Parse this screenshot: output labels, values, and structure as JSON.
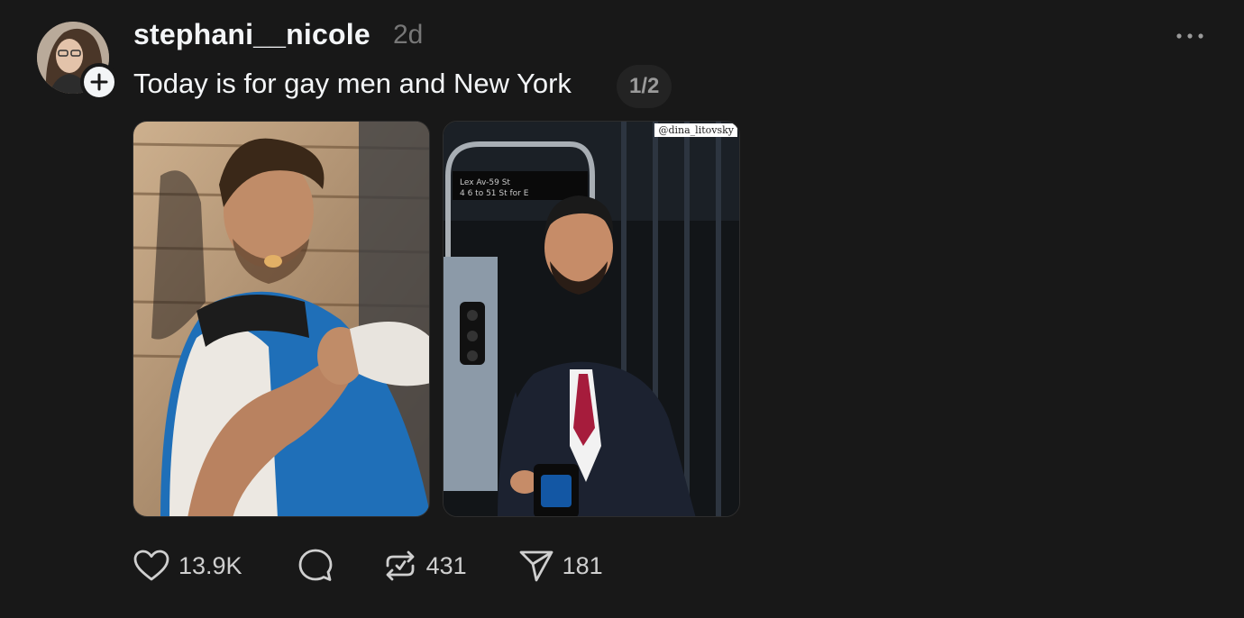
{
  "post": {
    "username": "stephani__nicole",
    "timestamp": "2d",
    "caption": "Today is for gay men and New York",
    "page_indicator": "1/2",
    "photo_credit": "@dina_litovsky",
    "stats": {
      "likes": "13.9K",
      "reposts": "431",
      "shares": "181"
    }
  },
  "colors": {
    "background": "#181818",
    "primary_text": "#f3f5f7",
    "secondary_text": "#777777",
    "icon": "#cfcfcf"
  },
  "icons": [
    "plus-icon",
    "more-icon",
    "heart-icon",
    "comment-icon",
    "repost-icon",
    "share-icon"
  ]
}
